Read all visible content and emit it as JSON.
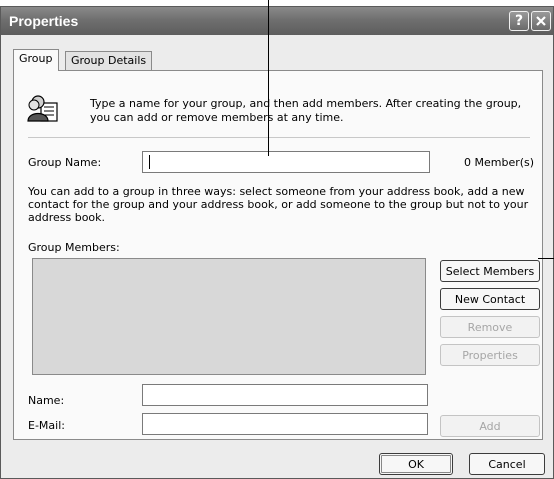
{
  "window": {
    "title": "Properties",
    "help_label": "?"
  },
  "tabs": [
    {
      "label": "Group",
      "active": true
    },
    {
      "label": "Group Details",
      "active": false
    }
  ],
  "intro_text": "Type a name for your group, and then add members. After creating the group, you can add or remove members at any time.",
  "group_name": {
    "label": "Group Name:",
    "value": "",
    "member_count": "0 Member(s)"
  },
  "help_text": "You can add to a group in three ways: select someone from your address book, add a new contact for the group and your address book, or add someone to the group but not to your address book.",
  "members": {
    "label": "Group Members:"
  },
  "buttons": {
    "select_members": "Select Members",
    "new_contact": "New Contact",
    "remove": "Remove",
    "properties": "Properties",
    "add": "Add",
    "ok": "OK",
    "cancel": "Cancel"
  },
  "name_field": {
    "label": "Name:",
    "value": ""
  },
  "email_field": {
    "label": "E-Mail:",
    "value": ""
  },
  "icons": {
    "group": "group-contacts-icon",
    "close": "close-icon"
  }
}
